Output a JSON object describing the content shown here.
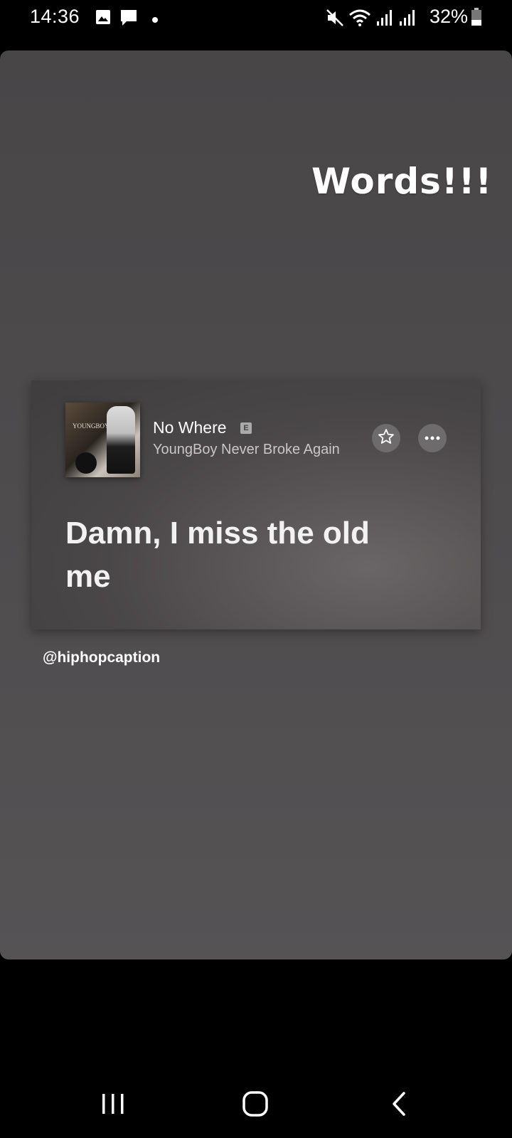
{
  "status_bar": {
    "time": "14:36",
    "battery_percent": "32%",
    "icons": [
      "gallery-icon",
      "message-icon",
      "dot-icon",
      "mute-icon",
      "wifi-icon",
      "signal-icon",
      "signal-icon-2",
      "battery-icon"
    ]
  },
  "story": {
    "caption": "Words!!!",
    "handle": "@hiphopcaption"
  },
  "lyric_card": {
    "song_title": "No Where",
    "explicit_badge": "E",
    "artist": "YoungBoy Never Broke Again",
    "album_art_text": "YOUNGBOY",
    "lyric": "Damn, I miss the old me"
  },
  "nav_bar": {
    "buttons": [
      "recent-apps-icon",
      "home-icon",
      "back-icon"
    ]
  }
}
